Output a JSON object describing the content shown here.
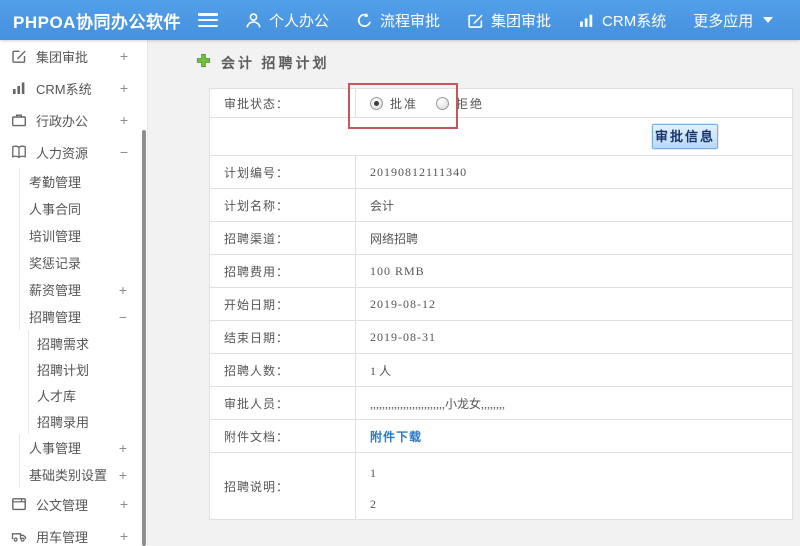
{
  "colors": {
    "header_blue": "#4a96e2",
    "accent_red": "#c4575c",
    "link_blue": "#2a7bc4",
    "add_green": "#6cbd3c"
  },
  "header": {
    "logo": "PHPOA协同办公软件",
    "nav": [
      {
        "label": "个人办公",
        "icon": "user-icon"
      },
      {
        "label": "流程审批",
        "icon": "process-icon"
      },
      {
        "label": "集团审批",
        "icon": "edit-square-icon"
      },
      {
        "label": "CRM系统",
        "icon": "bar-chart-icon"
      },
      {
        "label": "更多应用",
        "icon": "caret-down-icon"
      }
    ]
  },
  "sidebar": {
    "items": [
      {
        "label": "集团审批",
        "icon": "edit-square-icon",
        "toggle": "+",
        "level": 0
      },
      {
        "label": "CRM系统",
        "icon": "bar-chart-icon",
        "toggle": "+",
        "level": 0
      },
      {
        "label": "行政办公",
        "icon": "briefcase-icon",
        "toggle": "+",
        "level": 0
      },
      {
        "label": "人力资源",
        "icon": "book-icon",
        "toggle": "−",
        "level": 0
      },
      {
        "label": "考勤管理",
        "level": 1
      },
      {
        "label": "人事合同",
        "level": 1
      },
      {
        "label": "培训管理",
        "level": 1
      },
      {
        "label": "奖惩记录",
        "level": 1
      },
      {
        "label": "薪资管理",
        "toggle": "+",
        "level": 1
      },
      {
        "label": "招聘管理",
        "toggle": "−",
        "level": 1
      },
      {
        "label": "招聘需求",
        "level": 2
      },
      {
        "label": "招聘计划",
        "level": 2
      },
      {
        "label": "人才库",
        "level": 2
      },
      {
        "label": "招聘录用",
        "level": 2
      },
      {
        "label": "人事管理",
        "toggle": "+",
        "level": 1
      },
      {
        "label": "基础类别设置",
        "toggle": "+",
        "level": 1
      },
      {
        "label": "公文管理",
        "icon": "document-icon",
        "toggle": "+",
        "level": 0
      },
      {
        "label": "用车管理",
        "icon": "car-icon",
        "toggle": "+",
        "level": 0
      }
    ]
  },
  "main": {
    "breadcrumb": {
      "add_icon": "add-icon",
      "title": "会计 招聘计划"
    },
    "approval": {
      "label": "审批状态：",
      "options": [
        {
          "label": "批准",
          "selected": true
        },
        {
          "label": "拒绝",
          "selected": false
        }
      ]
    },
    "approve_button": "审批信息",
    "rows": [
      {
        "label": "计划编号：",
        "value": "20190812111340"
      },
      {
        "label": "计划名称：",
        "value": "会计"
      },
      {
        "label": "招聘渠道：",
        "value": "网络招聘"
      },
      {
        "label": "招聘费用：",
        "value": "100 RMB"
      },
      {
        "label": "开始日期：",
        "value": "2019-08-12"
      },
      {
        "label": "结束日期：",
        "value": "2019-08-31"
      },
      {
        "label": "招聘人数：",
        "value": "1 人"
      },
      {
        "label": "审批人员：",
        "value": ",,,,,,,,,,,,,,,,,,,,,,,,,小龙女,,,,,,,,"
      }
    ],
    "attachment": {
      "label": "附件文档：",
      "link_text": "附件下载"
    },
    "description": {
      "label": "招聘说明：",
      "line1": "1",
      "line2": "2"
    }
  }
}
